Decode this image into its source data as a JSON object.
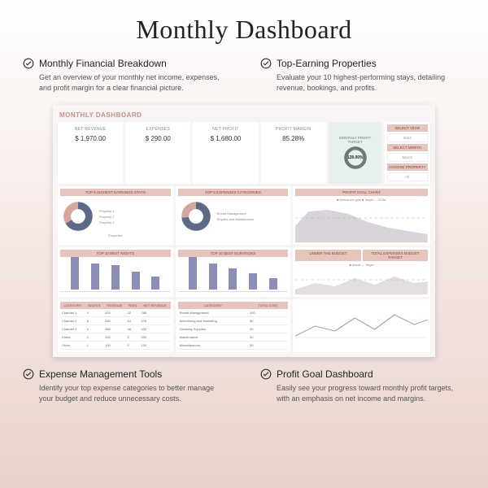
{
  "title": "Monthly Dashboard",
  "features": [
    {
      "title": "Monthly Financial Breakdown",
      "desc": "Get an overview of your monthly net income, expenses, and profit margin for a clear financial picture."
    },
    {
      "title": "Top-Earning Properties",
      "desc": "Evaluate your 10 highest-performing stays, detailing revenue, bookings, and profits."
    },
    {
      "title": "Expense Management Tools",
      "desc": "Identify your top expense categories to better manage your budget and reduce unnecessary costs."
    },
    {
      "title": "Profit Goal Dashboard",
      "desc": "Easily see your progress toward monthly profit targets, with an emphasis on net income and margins."
    }
  ],
  "dashboard": {
    "header": "MONTHLY DASHBOARD",
    "kpis": [
      {
        "label": "NET REVENUE",
        "value": "$ 1,970.00"
      },
      {
        "label": "EXPENSES",
        "value": "$ 290.00"
      },
      {
        "label": "NET PROFIT",
        "value": "$ 1,680.00"
      },
      {
        "label": "PROFIT MARGIN",
        "value": "85.28%"
      }
    ],
    "target": {
      "label": "MONTHLY PROFIT TARGET",
      "value": "128.00%"
    },
    "selector": {
      "title": "SELECT YEAR",
      "year": "2024",
      "month_title": "SELECT MONTH",
      "month": "March",
      "prop_title": "CHOOSE PROPERTY",
      "prop": "All"
    },
    "donut1": {
      "title": "TOP 5 HIGHEST EARNINGS STAYS",
      "legend": [
        "Property 1",
        "Property 2",
        "Property 3"
      ],
      "footer": "Properties"
    },
    "donut2": {
      "title": "TOP 5 EXPENSES CATEGORIES",
      "legend": [
        "Rental Management",
        "Repairs and Maintenance"
      ]
    },
    "profit_chart": {
      "title": "PROFIT GOAL CHART",
      "legend": "■ Behind the goal     ■ Target     — GOAL"
    },
    "bars1": {
      "title": "TOP 10 BEST NIGHTS",
      "values": [
        40,
        32,
        30,
        22,
        16
      ]
    },
    "bars2": {
      "title": "TOP 10 BEST DURATIONS",
      "values": [
        40,
        32,
        26,
        20,
        14
      ]
    },
    "book_table": {
      "headers": [
        "CATEGORY",
        "NIGHTS",
        "REVENUE",
        "FEES",
        "NET REVENUE"
      ],
      "rows": [
        [
          "Channel 1",
          "4",
          "320",
          "32",
          "288"
        ],
        [
          "Channel 2",
          "8",
          "640",
          "64",
          "576"
        ],
        [
          "Channel 3",
          "6",
          "480",
          "48",
          "432"
        ],
        [
          "Direct",
          "2",
          "200",
          "0",
          "200"
        ],
        [
          "Other",
          "1",
          "100",
          "0",
          "100"
        ]
      ]
    },
    "exp_table": {
      "headers": [
        "CATEGORY",
        "TOTAL COST"
      ],
      "rows": [
        [
          "Rental Management",
          "120"
        ],
        [
          "Advertising and Marketing",
          "50"
        ],
        [
          "Cleaning Supplies",
          "40"
        ],
        [
          "Maintenance",
          "50"
        ],
        [
          "Miscellaneous",
          "30"
        ]
      ]
    },
    "budget_chart": {
      "title": "UNDER THE BUDGET",
      "legend": "■ Actual     — Target",
      "total_label": "TOTAL EXPENSES BUDGET TARGET"
    }
  }
}
